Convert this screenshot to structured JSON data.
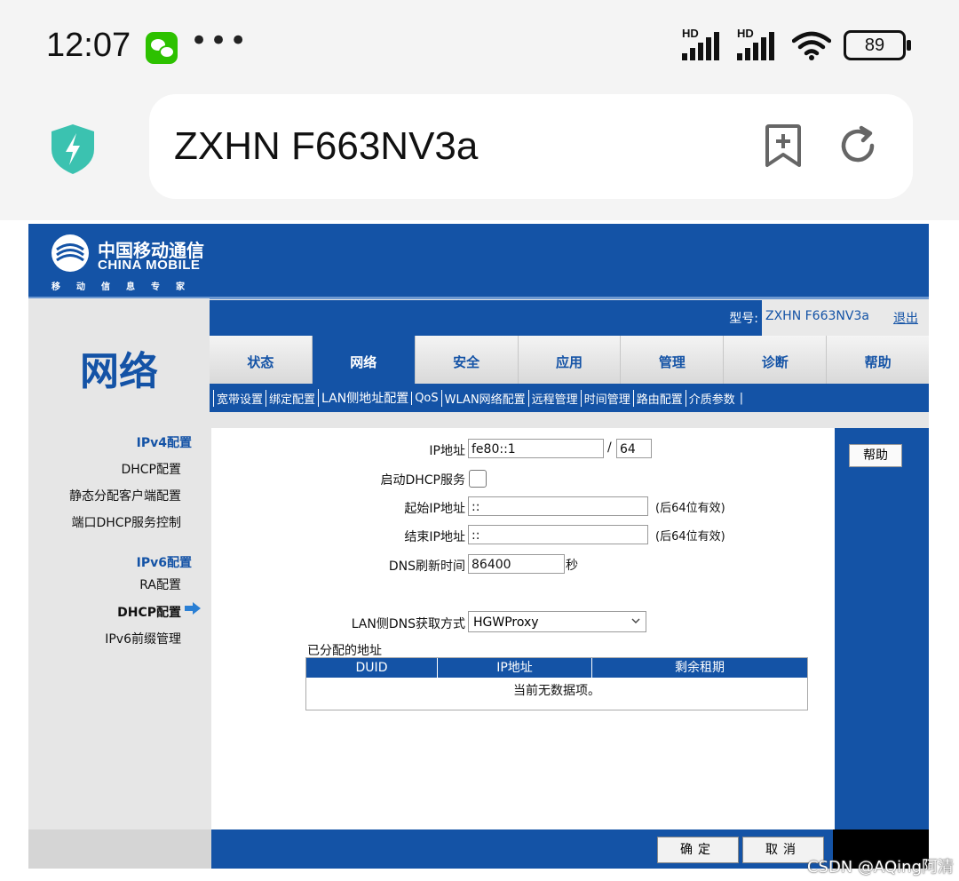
{
  "status_bar": {
    "time": "12:07",
    "more": "•••",
    "hd": "HD",
    "battery": "89"
  },
  "browser": {
    "url_title": "ZXHN F663NV3a"
  },
  "brand": {
    "name_cn": "中国移动通信",
    "name_en": "CHINA MOBILE",
    "slogan": "移动信息专家"
  },
  "section_title": "网络",
  "model": {
    "label": "型号:",
    "value": "ZXHN F663NV3a",
    "logout": "退出"
  },
  "tabs": [
    {
      "label": "状态",
      "active": false
    },
    {
      "label": "网络",
      "active": true
    },
    {
      "label": "安全",
      "active": false
    },
    {
      "label": "应用",
      "active": false
    },
    {
      "label": "管理",
      "active": false
    },
    {
      "label": "诊断",
      "active": false
    },
    {
      "label": "帮助",
      "active": false
    }
  ],
  "subnav": [
    "宽带设置",
    "绑定配置",
    "LAN侧地址配置",
    "QoS",
    "WLAN网络配置",
    "远程管理",
    "时间管理",
    "路由配置",
    "介质参数"
  ],
  "subnav_end": "|",
  "leftnav": {
    "ipv4_group": "IPv4配置",
    "ipv4_items": [
      "DHCP配置",
      "静态分配客户端配置",
      "端口DHCP服务控制"
    ],
    "ipv6_group": "IPv6配置",
    "ipv6_items": [
      "RA配置",
      "DHCP配置",
      "IPv6前缀管理"
    ]
  },
  "form": {
    "ip_label": "IP地址",
    "ip_value": "fe80::1",
    "slash": "/",
    "prefix_value": "64",
    "dhcp_label": "启动DHCP服务",
    "start_label": "起始IP地址",
    "start_value": "::",
    "start_hint": "(后64位有效)",
    "end_label": "结束IP地址",
    "end_value": "::",
    "end_hint": "(后64位有效)",
    "dns_refresh_label": "DNS刷新时间",
    "dns_refresh_value": "86400",
    "dns_refresh_unit": "秒",
    "lan_dns_label": "LAN侧DNS获取方式",
    "lan_dns_value": "HGWProxy",
    "assigned_label": "已分配的地址"
  },
  "table": {
    "headers": [
      "DUID",
      "IP地址",
      "剩余租期"
    ],
    "empty": "当前无数据项。"
  },
  "help_button": "帮助",
  "buttons": {
    "ok": "确定",
    "cancel": "取消"
  },
  "watermark": "CSDN @AQing阿清",
  "colors": {
    "brand_blue": "#1453a6",
    "panel_gray": "#e6e6e6"
  }
}
